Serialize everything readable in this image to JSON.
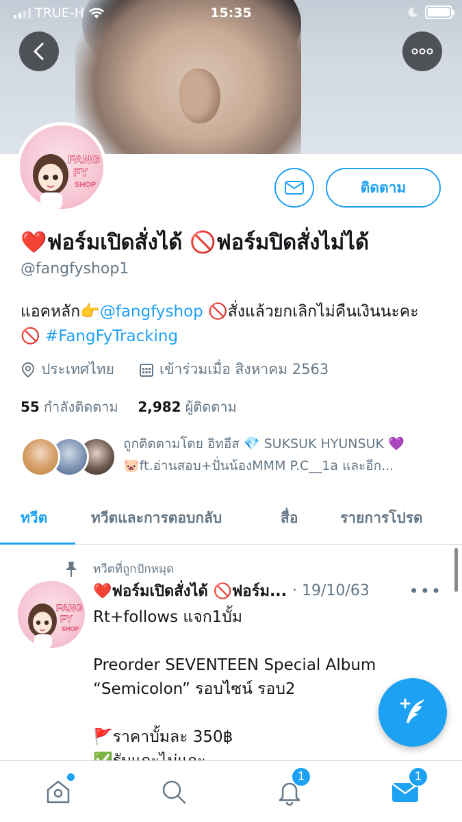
{
  "status_bar": {
    "carrier": "TRUE-H",
    "time": "15:35"
  },
  "profile": {
    "name": "❤️ฟอร์มเปิดสั่งได้ 🚫ฟอร์มปิดสั่งไม่ได้",
    "handle": "@fangfyshop1",
    "follow_label": "ติดตาม",
    "bio": {
      "prefix": "แอคหลัก👉",
      "main_link": "@fangfyshop",
      "middle": " 🚫สั่งแล้วยกเลิกไม่คืนเงินนะคะ🚫 ",
      "hashtag": "#FangFyTracking"
    },
    "location": "ประเทศไทย",
    "joined": "เข้าร่วมเมื่อ สิงหาคม 2563",
    "following_count": "55",
    "following_label": "กำลังติดตาม",
    "followers_count": "2,982",
    "followers_label": "ผู้ติดตาม",
    "followed_by_line1": "ถูกติดตามโดย อิทอีส 💎 SUKSUK HYUNSUK 💜",
    "followed_by_line2": "🐷ft.อ่านสอบ+ปั่นน้องMMM P.C__1a และอีก..."
  },
  "tabs": [
    "ทวีต",
    "ทวีตและการตอบกลับ",
    "สื่อ",
    "รายการโปรด"
  ],
  "pinned_label": "ทวีตที่ถูกปักหมุด",
  "tweet": {
    "name": "❤️ฟอร์มเปิดสั่งได้ 🚫ฟอร์ม...",
    "date": "· 19/10/63",
    "body": "Rt+follows  แจก1บั้ม\n\nPreorder SEVENTEEN Special Album\n“Semicolon” รอบไซน์ รอบ2\n\n🚩ราคาบั้มละ 350฿\n✅รับแกะไม่แกะ"
  },
  "nav": {
    "notifications_badge": "1",
    "messages_badge": "1"
  },
  "colors": {
    "accent": "#1da1f2",
    "secondary_text": "#657786"
  }
}
